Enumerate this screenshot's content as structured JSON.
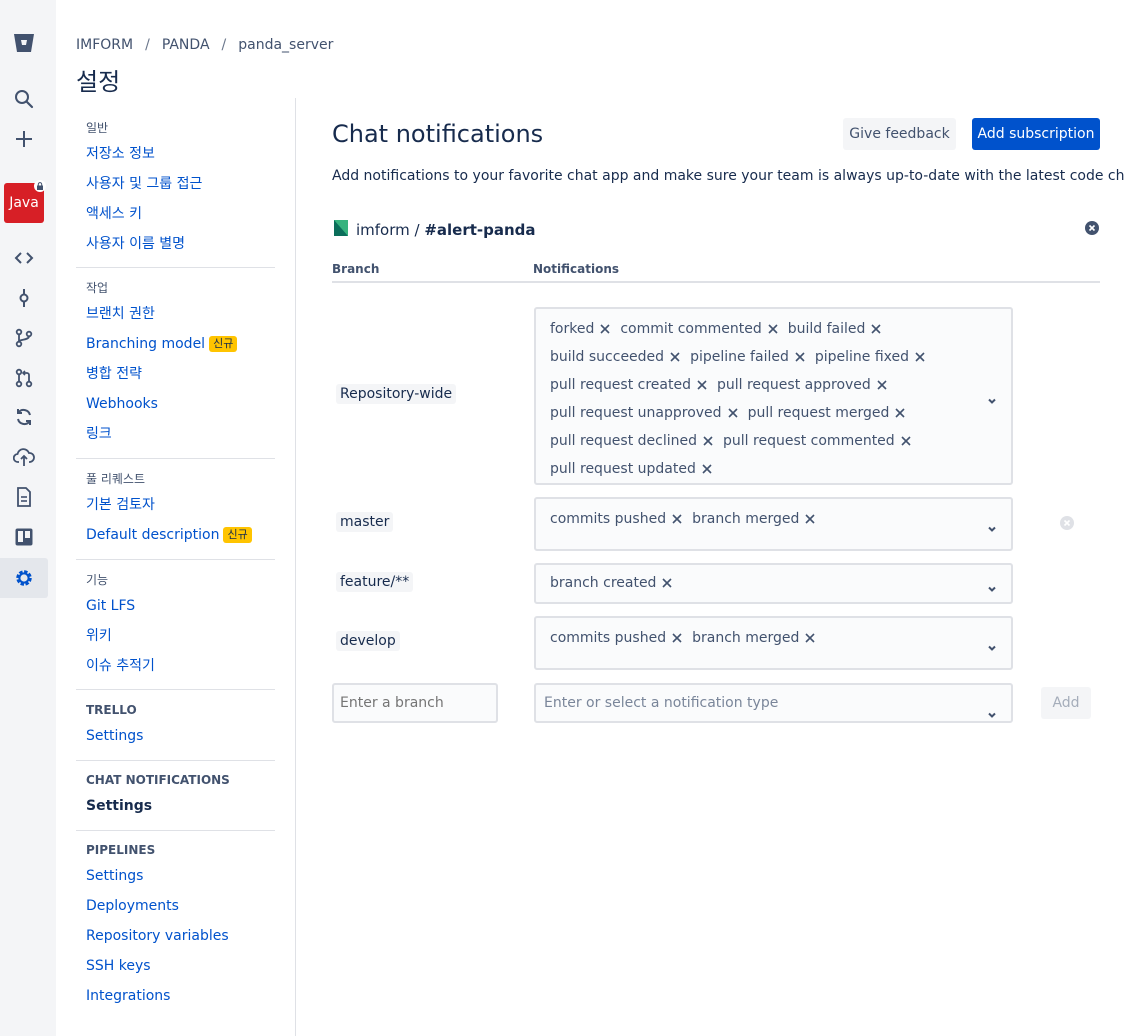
{
  "rail": {
    "icons": [
      "bitbucket-logo-icon",
      "search-icon",
      "plus-icon",
      "repo-avatar",
      "source-icon",
      "commits-icon",
      "branches-icon",
      "pull-requests-icon",
      "pipelines-icon",
      "deployments-icon",
      "wiki-icon",
      "trello-board-icon",
      "settings-icon"
    ],
    "repo_avatar_label": "Java",
    "accent": "#0052cc",
    "avatar_color": "#d71f26"
  },
  "breadcrumb": [
    "IMFORM",
    "PANDA",
    "panda_server"
  ],
  "page_title": "설정",
  "sidebar": {
    "groups": [
      {
        "heading": "일반",
        "items": [
          {
            "label": "저장소 정보"
          },
          {
            "label": "사용자 및 그룹 접근"
          },
          {
            "label": "액세스 키"
          },
          {
            "label": "사용자 이름 별명"
          }
        ]
      },
      {
        "heading": "작업",
        "items": [
          {
            "label": "브랜치 권한"
          },
          {
            "label": "Branching model",
            "badge": "신규"
          },
          {
            "label": "병합 전략"
          },
          {
            "label": "Webhooks"
          },
          {
            "label": "링크"
          }
        ]
      },
      {
        "heading": "풀 리퀘스트",
        "items": [
          {
            "label": "기본 검토자"
          },
          {
            "label": "Default description",
            "badge": "신규"
          }
        ]
      },
      {
        "heading": "기능",
        "items": [
          {
            "label": "Git LFS"
          },
          {
            "label": "위키"
          },
          {
            "label": "이슈 추적기"
          }
        ]
      },
      {
        "heading": "TRELLO",
        "items": [
          {
            "label": "Settings"
          }
        ]
      },
      {
        "heading": "CHAT NOTIFICATIONS",
        "items": [
          {
            "label": "Settings",
            "current": true
          }
        ]
      },
      {
        "heading": "PIPELINES",
        "items": [
          {
            "label": "Settings"
          },
          {
            "label": "Deployments"
          },
          {
            "label": "Repository variables"
          },
          {
            "label": "SSH keys"
          },
          {
            "label": "Integrations"
          }
        ]
      }
    ]
  },
  "main": {
    "title": "Chat notifications",
    "feedback_button": "Give feedback",
    "add_subscription_button": "Add subscription",
    "description": "Add notifications to your favorite chat app and make sure your team is always up-to-date with the latest code changes.",
    "subscription": {
      "workspace": "imform / ",
      "channel": "#alert-panda",
      "col_branch": "Branch",
      "col_notifications": "Notifications",
      "rows": [
        {
          "branch": "Repository-wide",
          "tags": [
            "forked",
            "commit commented",
            "build failed",
            "build succeeded",
            "pipeline failed",
            "pipeline fixed",
            "pull request created",
            "pull request approved",
            "pull request unapproved",
            "pull request merged",
            "pull request declined",
            "pull request commented",
            "pull request updated"
          ]
        },
        {
          "branch": "master",
          "tags": [
            "commits pushed",
            "branch merged"
          ]
        },
        {
          "branch": "feature/**",
          "tags": [
            "branch created"
          ]
        },
        {
          "branch": "develop",
          "tags": [
            "commits pushed",
            "branch merged"
          ]
        }
      ]
    },
    "new_row": {
      "branch_placeholder": "Enter a branch",
      "type_placeholder": "Enter or select a notification type",
      "add_button": "Add"
    }
  }
}
